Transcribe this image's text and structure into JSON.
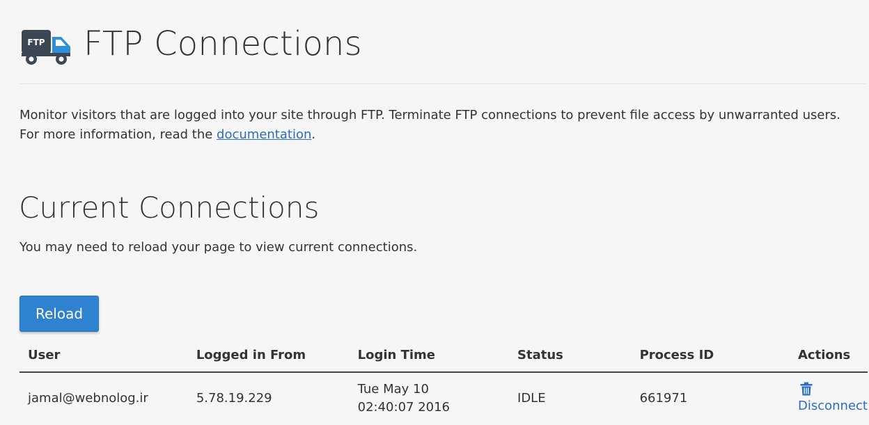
{
  "header": {
    "logo_text": "FTP",
    "title": "FTP Connections"
  },
  "description": {
    "text_before": "Monitor visitors that are logged into your site through FTP. Terminate FTP connections to prevent file access by unwarranted users. For more information, read the ",
    "link_text": "documentation",
    "text_after": "."
  },
  "current_connections": {
    "title": "Current Connections",
    "subtitle": "You may need to reload your page to view current connections.",
    "reload_label": "Reload"
  },
  "table": {
    "headers": {
      "user": "User",
      "logged_from": "Logged in From",
      "login_time": "Login Time",
      "status": "Status",
      "process_id": "Process ID",
      "actions": "Actions"
    },
    "rows": [
      {
        "user": "jamal@webnolog.ir",
        "logged_from": "5.78.19.229",
        "login_time_line1": "Tue May 10",
        "login_time_line2": "02:40:07 2016",
        "status": "IDLE",
        "process_id": "661971",
        "action_label": "Disconnect",
        "action_icon": "trash-icon"
      }
    ]
  },
  "colors": {
    "background": "#f6f6f6",
    "accent": "#2e82cf",
    "link": "#2a6ebd",
    "logo_dark": "#3b4753",
    "logo_blue": "#2f8fd8"
  }
}
